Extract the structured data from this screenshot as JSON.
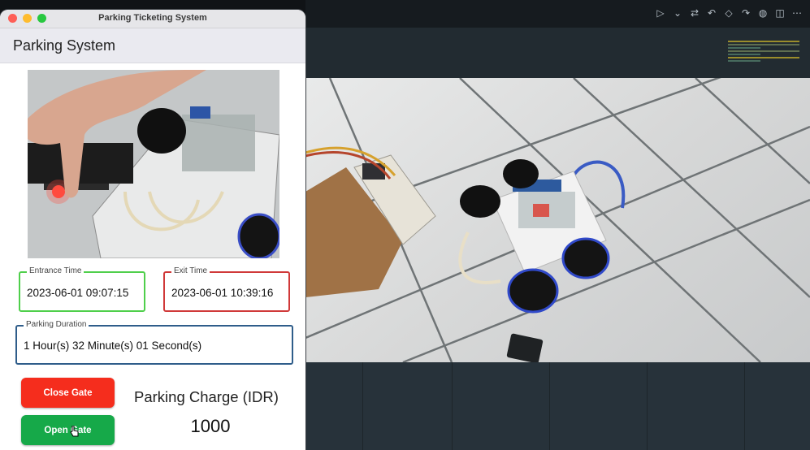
{
  "window": {
    "title": "Parking Ticketing System"
  },
  "appbar": {
    "title": "Parking System"
  },
  "fields": {
    "entrance": {
      "label": "Entrance Time",
      "value": "2023-06-01 09:07:15",
      "border_color": "#4fcf4b"
    },
    "exit": {
      "label": "Exit Time",
      "value": "2023-06-01 10:39:16",
      "border_color": "#d03939"
    },
    "duration": {
      "label": "Parking Duration",
      "value": "1 Hour(s) 32 Minute(s) 01 Second(s)",
      "border_color": "#2f5d8a"
    }
  },
  "buttons": {
    "close_gate": "Close Gate",
    "open_gate": "Open Gate"
  },
  "charge": {
    "label": "Parking Charge (IDR)",
    "value": "1000"
  },
  "editor_toolbar": {
    "icons": [
      "run-icon",
      "chevron-down-icon",
      "compare-icon",
      "go-back-icon",
      "dot-icon",
      "go-forward-icon",
      "account-icon",
      "split-editor-icon",
      "more-icon"
    ]
  },
  "colors": {
    "close_button": "#f52d1d",
    "open_button": "#16a949",
    "editor_bg": "#222b31"
  }
}
